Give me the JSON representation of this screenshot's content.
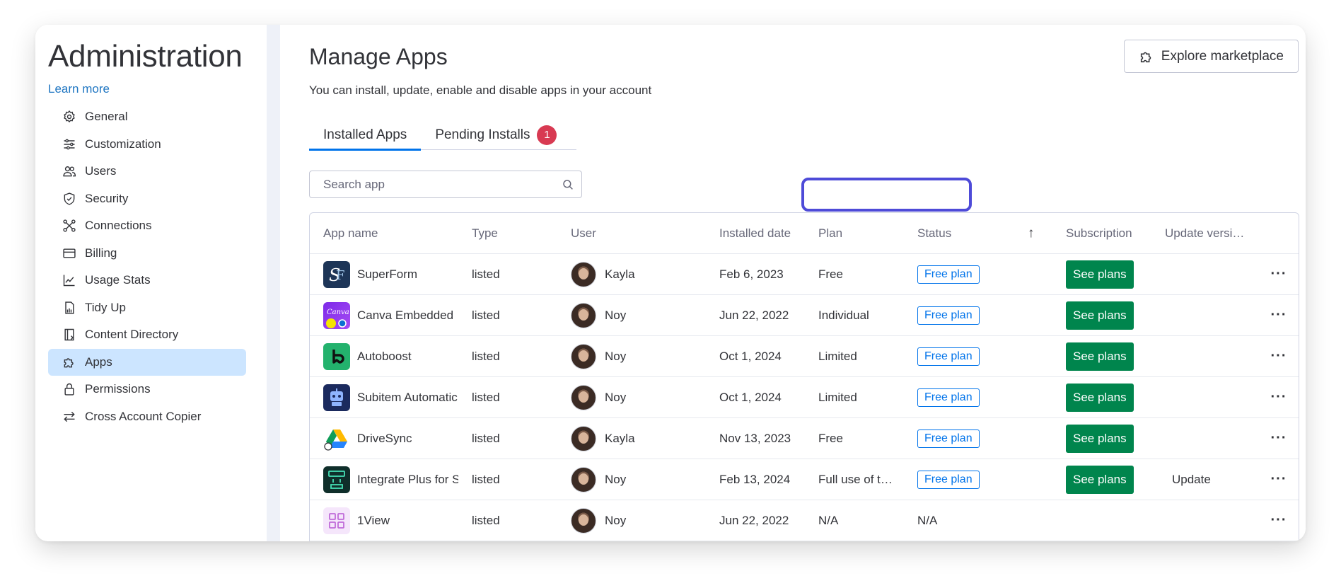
{
  "sidebar": {
    "title": "Administration",
    "learn_more": "Learn more",
    "items": [
      {
        "label": "General",
        "icon": "gear-icon"
      },
      {
        "label": "Customization",
        "icon": "sliders-icon"
      },
      {
        "label": "Users",
        "icon": "users-icon"
      },
      {
        "label": "Security",
        "icon": "shield-icon"
      },
      {
        "label": "Connections",
        "icon": "connections-icon"
      },
      {
        "label": "Billing",
        "icon": "credit-card-icon"
      },
      {
        "label": "Usage Stats",
        "icon": "chart-icon"
      },
      {
        "label": "Tidy Up",
        "icon": "broom-icon"
      },
      {
        "label": "Content Directory",
        "icon": "directory-icon"
      },
      {
        "label": "Apps",
        "icon": "puzzle-icon",
        "active": true
      },
      {
        "label": "Permissions",
        "icon": "lock-icon"
      },
      {
        "label": "Cross Account Copier",
        "icon": "swap-arrows-icon"
      }
    ]
  },
  "main": {
    "title": "Manage Apps",
    "subtitle": "You can install, update, enable and disable apps in your account",
    "explore_button": "Explore marketplace",
    "tabs": [
      {
        "label": "Installed Apps",
        "active": true
      },
      {
        "label": "Pending Installs",
        "badge": "1"
      }
    ],
    "search": {
      "placeholder": "Search app",
      "value": ""
    }
  },
  "table": {
    "columns": {
      "name": "App name",
      "type": "Type",
      "user": "User",
      "date": "Installed date",
      "plan": "Plan",
      "status": "Status",
      "sort": "↑",
      "subscription": "Subscription",
      "update": "Update versi…"
    },
    "rows": [
      {
        "name": "SuperForm",
        "type": "listed",
        "user": "Kayla",
        "date": "Feb 6, 2023",
        "plan": "Free",
        "status": "Free plan",
        "subscription": "See plans",
        "update": ""
      },
      {
        "name": "Canva Embedded",
        "type": "listed",
        "user": "Noy",
        "date": "Jun 22, 2022",
        "plan": "Individual",
        "status": "Free plan",
        "subscription": "See plans",
        "update": ""
      },
      {
        "name": "Autoboost",
        "type": "listed",
        "user": "Noy",
        "date": "Oct 1, 2024",
        "plan": "Limited",
        "status": "Free plan",
        "subscription": "See plans",
        "update": ""
      },
      {
        "name": "Subitem Automatic",
        "type": "listed",
        "user": "Noy",
        "date": "Oct 1, 2024",
        "plan": "Limited",
        "status": "Free plan",
        "subscription": "See plans",
        "update": ""
      },
      {
        "name": "DriveSync",
        "type": "listed",
        "user": "Kayla",
        "date": "Nov 13, 2023",
        "plan": "Free",
        "status": "Free plan",
        "subscription": "See plans",
        "update": ""
      },
      {
        "name": "Integrate Plus for S",
        "type": "listed",
        "user": "Noy",
        "date": "Feb 13, 2024",
        "plan": "Full use of t…",
        "status": "Free plan",
        "subscription": "See plans",
        "update": "Update"
      },
      {
        "name": "1View",
        "type": "listed",
        "user": "Noy",
        "date": "Jun 22, 2022",
        "plan": "N/A",
        "status": "N/A",
        "subscription": "",
        "update": ""
      }
    ]
  },
  "colors": {
    "accent": "#0073ea",
    "active_nav": "#cce5ff",
    "see_plans": "#00854d",
    "badge": "#d83a52",
    "highlight": "#4e4bd8"
  }
}
